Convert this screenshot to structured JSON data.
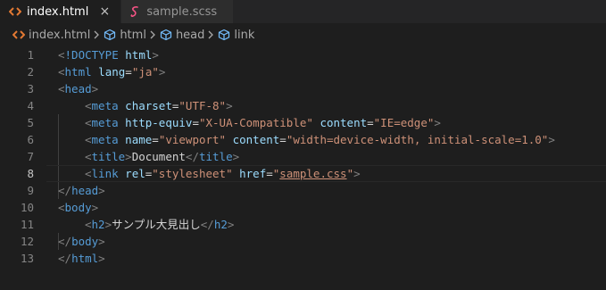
{
  "tabs": [
    {
      "label": "index.html",
      "active": true,
      "icon": "html-file-icon",
      "close": "×"
    },
    {
      "label": "sample.scss",
      "active": false,
      "icon": "sass-file-icon"
    }
  ],
  "breadcrumb": [
    {
      "label": "index.html",
      "icon": "html-file-icon"
    },
    {
      "label": "html",
      "icon": "element-cube-icon"
    },
    {
      "label": "head",
      "icon": "element-cube-icon"
    },
    {
      "label": "link",
      "icon": "element-cube-icon"
    }
  ],
  "current_line": 8,
  "lines": [
    {
      "n": "1",
      "indent": 0,
      "tokens": [
        [
          "punc",
          "<"
        ],
        [
          "tag",
          "!DOCTYPE"
        ],
        [
          "text",
          " "
        ],
        [
          "attr",
          "html"
        ],
        [
          "punc",
          ">"
        ]
      ]
    },
    {
      "n": "2",
      "indent": 0,
      "tokens": [
        [
          "punc",
          "<"
        ],
        [
          "tag",
          "html"
        ],
        [
          "text",
          " "
        ],
        [
          "attr",
          "lang"
        ],
        [
          "text",
          "="
        ],
        [
          "str",
          "\"ja\""
        ],
        [
          "punc",
          ">"
        ]
      ]
    },
    {
      "n": "3",
      "indent": 0,
      "tokens": [
        [
          "punc",
          "<"
        ],
        [
          "tag",
          "head"
        ],
        [
          "punc",
          ">"
        ]
      ]
    },
    {
      "n": "4",
      "indent": 1,
      "tokens": [
        [
          "punc",
          "<"
        ],
        [
          "tag",
          "meta"
        ],
        [
          "text",
          " "
        ],
        [
          "attr",
          "charset"
        ],
        [
          "text",
          "="
        ],
        [
          "str",
          "\"UTF-8\""
        ],
        [
          "punc",
          ">"
        ]
      ]
    },
    {
      "n": "5",
      "indent": 1,
      "tokens": [
        [
          "punc",
          "<"
        ],
        [
          "tag",
          "meta"
        ],
        [
          "text",
          " "
        ],
        [
          "attr",
          "http-equiv"
        ],
        [
          "text",
          "="
        ],
        [
          "str",
          "\"X-UA-Compatible\""
        ],
        [
          "text",
          " "
        ],
        [
          "attr",
          "content"
        ],
        [
          "text",
          "="
        ],
        [
          "str",
          "\"IE=edge\""
        ],
        [
          "punc",
          ">"
        ]
      ]
    },
    {
      "n": "6",
      "indent": 1,
      "tokens": [
        [
          "punc",
          "<"
        ],
        [
          "tag",
          "meta"
        ],
        [
          "text",
          " "
        ],
        [
          "attr",
          "name"
        ],
        [
          "text",
          "="
        ],
        [
          "str",
          "\"viewport\""
        ],
        [
          "text",
          " "
        ],
        [
          "attr",
          "content"
        ],
        [
          "text",
          "="
        ],
        [
          "str",
          "\"width=device-width, initial-scale=1.0\""
        ],
        [
          "punc",
          ">"
        ]
      ]
    },
    {
      "n": "7",
      "indent": 1,
      "tokens": [
        [
          "punc",
          "<"
        ],
        [
          "tag",
          "title"
        ],
        [
          "punc",
          ">"
        ],
        [
          "text",
          "Document"
        ],
        [
          "punc",
          "</"
        ],
        [
          "tag",
          "title"
        ],
        [
          "punc",
          ">"
        ]
      ]
    },
    {
      "n": "8",
      "indent": 1,
      "tokens": [
        [
          "punc",
          "<"
        ],
        [
          "tag",
          "link"
        ],
        [
          "text",
          " "
        ],
        [
          "attr",
          "rel"
        ],
        [
          "text",
          "="
        ],
        [
          "str",
          "\"stylesheet\""
        ],
        [
          "text",
          " "
        ],
        [
          "attr",
          "href"
        ],
        [
          "text",
          "="
        ],
        [
          "str",
          "\""
        ],
        [
          "strlink",
          "sample.css"
        ],
        [
          "str",
          "\""
        ],
        [
          "punc",
          ">"
        ]
      ]
    },
    {
      "n": "9",
      "indent": 0,
      "tokens": [
        [
          "punc",
          "</"
        ],
        [
          "tag",
          "head"
        ],
        [
          "punc",
          ">"
        ]
      ]
    },
    {
      "n": "10",
      "indent": 0,
      "tokens": [
        [
          "punc",
          "<"
        ],
        [
          "tag",
          "body"
        ],
        [
          "punc",
          ">"
        ]
      ]
    },
    {
      "n": "11",
      "indent": 1,
      "tokens": [
        [
          "punc",
          "<"
        ],
        [
          "tag",
          "h2"
        ],
        [
          "punc",
          ">"
        ],
        [
          "text",
          "サンプル大見出し"
        ],
        [
          "punc",
          "</"
        ],
        [
          "tag",
          "h2"
        ],
        [
          "punc",
          ">"
        ]
      ]
    },
    {
      "n": "12",
      "indent": 0,
      "tokens": [
        [
          "punc",
          "</"
        ],
        [
          "tag",
          "body"
        ],
        [
          "punc",
          ">"
        ]
      ]
    },
    {
      "n": "13",
      "indent": 0,
      "tokens": [
        [
          "punc",
          "</"
        ],
        [
          "tag",
          "html"
        ],
        [
          "punc",
          ">"
        ]
      ]
    }
  ],
  "colors": {
    "background": "#1e1e1e",
    "tag": "#569cd6",
    "attribute": "#9cdcfe",
    "string": "#ce9178",
    "punctuation": "#808080",
    "text": "#d4d4d4",
    "html_icon": "#e37933",
    "sass_icon": "#f55385",
    "cube_icon": "#75beff"
  }
}
